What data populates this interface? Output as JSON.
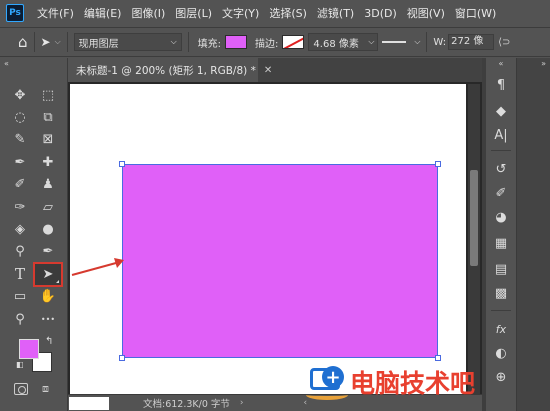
{
  "app": {
    "logo": "Ps"
  },
  "menu": [
    "文件(F)",
    "编辑(E)",
    "图像(I)",
    "图层(L)",
    "文字(Y)",
    "选择(S)",
    "滤镜(T)",
    "3D(D)",
    "视图(V)",
    "窗口(W)"
  ],
  "options": {
    "layer_mode": "现用图层",
    "fill_label": "填充:",
    "fill_color": "#e060f8",
    "stroke_label": "描边:",
    "stroke_width": "4.68 像素",
    "w_label": "W:",
    "w_value": "272 像"
  },
  "document": {
    "tab_title": "未标题-1 @ 200% (矩形 1, RGB/8) *",
    "status_info": "文档:612.3K/0 字节",
    "shape_color": "#e060f8",
    "canvas_color": "#ffffff"
  },
  "colors": {
    "foreground": "#e060f8",
    "background": "#ffffff",
    "selection_highlight": "#d63a2f",
    "annotation_arrow": "#d63a2f"
  },
  "tools": [
    {
      "name": "move-tool",
      "icon": "move-icon",
      "glyph": "✥"
    },
    {
      "name": "marquee-tool",
      "icon": "marquee-icon",
      "glyph": "⬚"
    },
    {
      "name": "lasso-tool",
      "icon": "lasso-icon",
      "glyph": "◌"
    },
    {
      "name": "object-select-tool",
      "icon": "object-select-icon",
      "glyph": "⧉"
    },
    {
      "name": "quick-select-tool",
      "icon": "quick-select-icon",
      "glyph": "✎"
    },
    {
      "name": "frame-tool",
      "icon": "frame-icon",
      "glyph": "⊠"
    },
    {
      "name": "eyedropper-tool",
      "icon": "eyedropper-icon",
      "glyph": "✒"
    },
    {
      "name": "healing-brush-tool",
      "icon": "bandage-icon",
      "glyph": "✚"
    },
    {
      "name": "brush-tool",
      "icon": "brush-icon",
      "glyph": "✐"
    },
    {
      "name": "stamp-tool",
      "icon": "stamp-icon",
      "glyph": "♟"
    },
    {
      "name": "history-brush-tool",
      "icon": "history-brush-icon",
      "glyph": "✑"
    },
    {
      "name": "eraser-tool",
      "icon": "eraser-icon",
      "glyph": "▱"
    },
    {
      "name": "paint-bucket-tool",
      "icon": "paint-bucket-icon",
      "glyph": "◈"
    },
    {
      "name": "blur-tool",
      "icon": "droplet-icon",
      "glyph": "●"
    },
    {
      "name": "dodge-tool",
      "icon": "dodge-icon",
      "glyph": "⚲"
    },
    {
      "name": "pen-tool",
      "icon": "pen-icon",
      "glyph": "✒"
    },
    {
      "name": "type-tool",
      "icon": "type-icon",
      "glyph": "T"
    },
    {
      "name": "path-select-tool",
      "icon": "arrow-cursor-icon",
      "glyph": "➤"
    },
    {
      "name": "rectangle-tool",
      "icon": "rectangle-icon",
      "glyph": "▭"
    },
    {
      "name": "hand-tool",
      "icon": "hand-icon",
      "glyph": "✋"
    },
    {
      "name": "zoom-tool",
      "icon": "zoom-icon",
      "glyph": "⚲"
    },
    {
      "name": "more-tools",
      "icon": "ellipsis-icon",
      "glyph": "•••"
    }
  ],
  "right_panel": [
    {
      "name": "paragraph-panel",
      "icon": "paragraph-icon",
      "glyph": "¶"
    },
    {
      "name": "layers-panel",
      "icon": "layers-icon",
      "glyph": "◆"
    },
    {
      "name": "character-panel",
      "icon": "character-icon",
      "glyph": "A|"
    },
    {
      "name": "history-panel",
      "icon": "history-icon",
      "glyph": "↺"
    },
    {
      "name": "brush-settings-panel",
      "icon": "brush-settings-icon",
      "glyph": "✐"
    },
    {
      "name": "color-panel",
      "icon": "palette-icon",
      "glyph": "◕"
    },
    {
      "name": "swatches-panel",
      "icon": "swatches-icon",
      "glyph": "▦"
    },
    {
      "name": "gradient-panel",
      "icon": "gradient-icon",
      "glyph": "▤"
    },
    {
      "name": "patterns-panel",
      "icon": "patterns-icon",
      "glyph": "▩"
    },
    {
      "name": "styles-panel",
      "icon": "fx-icon",
      "glyph": "fx"
    },
    {
      "name": "adjustments-panel",
      "icon": "adjustments-icon",
      "glyph": "◐"
    },
    {
      "name": "info-panel",
      "icon": "info-icon",
      "glyph": "⊕"
    }
  ],
  "watermark": {
    "text": "电脑技术吧"
  }
}
